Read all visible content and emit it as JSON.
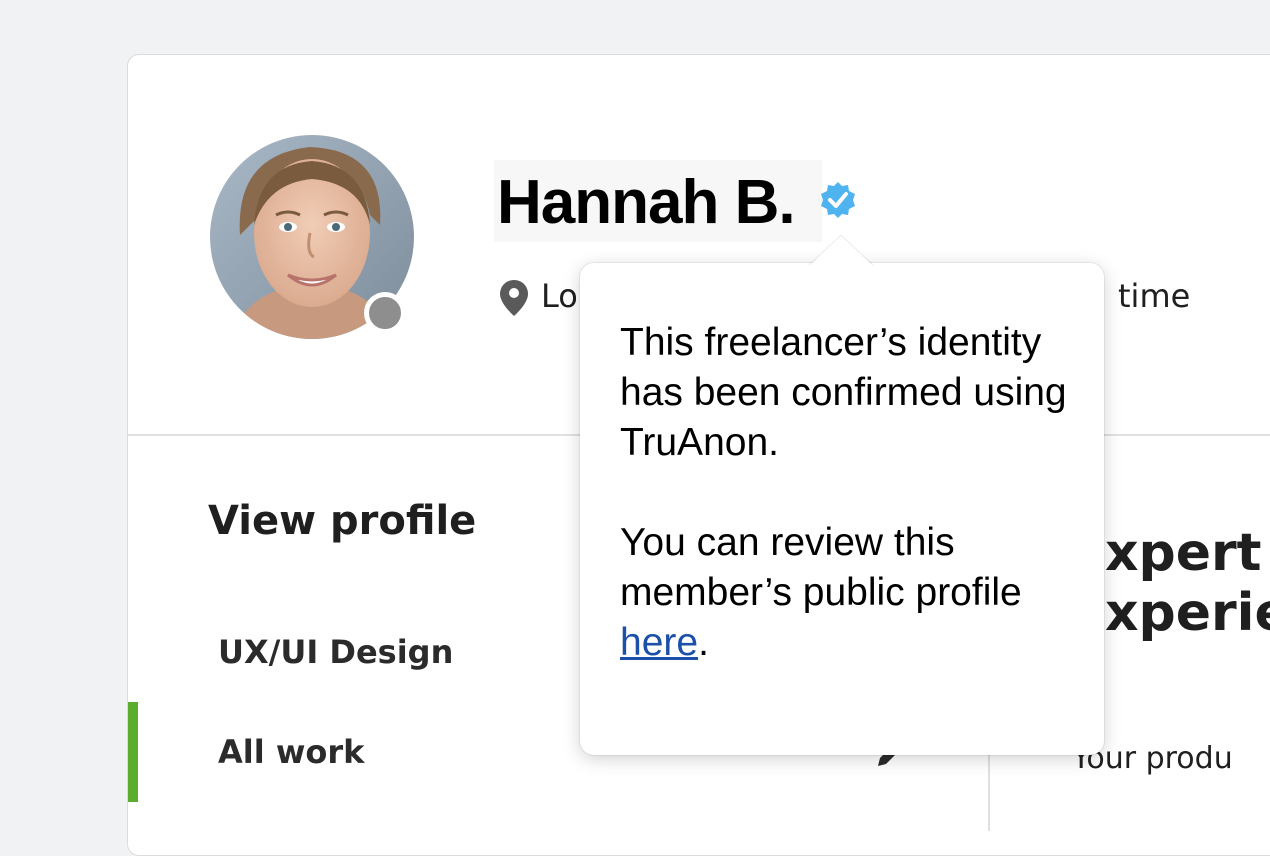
{
  "profile": {
    "name": "Hannah B.",
    "location_visible": "Lo",
    "local_time_visible": "time",
    "status": "offline"
  },
  "tooltip": {
    "paragraph1": "This freelancer’s identity has been confirmed using TruAnon.",
    "paragraph2_prefix": "You can review this member’s public profile ",
    "link_text": "here",
    "paragraph2_suffix": "."
  },
  "sidebar": {
    "title": "View profile",
    "items": [
      {
        "label": "UX/UI Design",
        "active": false
      },
      {
        "label": "All work",
        "active": true
      }
    ]
  },
  "main": {
    "heading_line1": "xpert",
    "heading_line2": "xperie",
    "body_text": "Your produ"
  },
  "colors": {
    "accent_green": "#5aad2e",
    "verified_blue": "#4fb3f0",
    "link_blue": "#1b4fa8",
    "status_gray": "#8e8e8e"
  },
  "icons": {
    "verified": "verified-badge-icon",
    "location": "map-pin-icon",
    "edit": "pencil-icon"
  }
}
